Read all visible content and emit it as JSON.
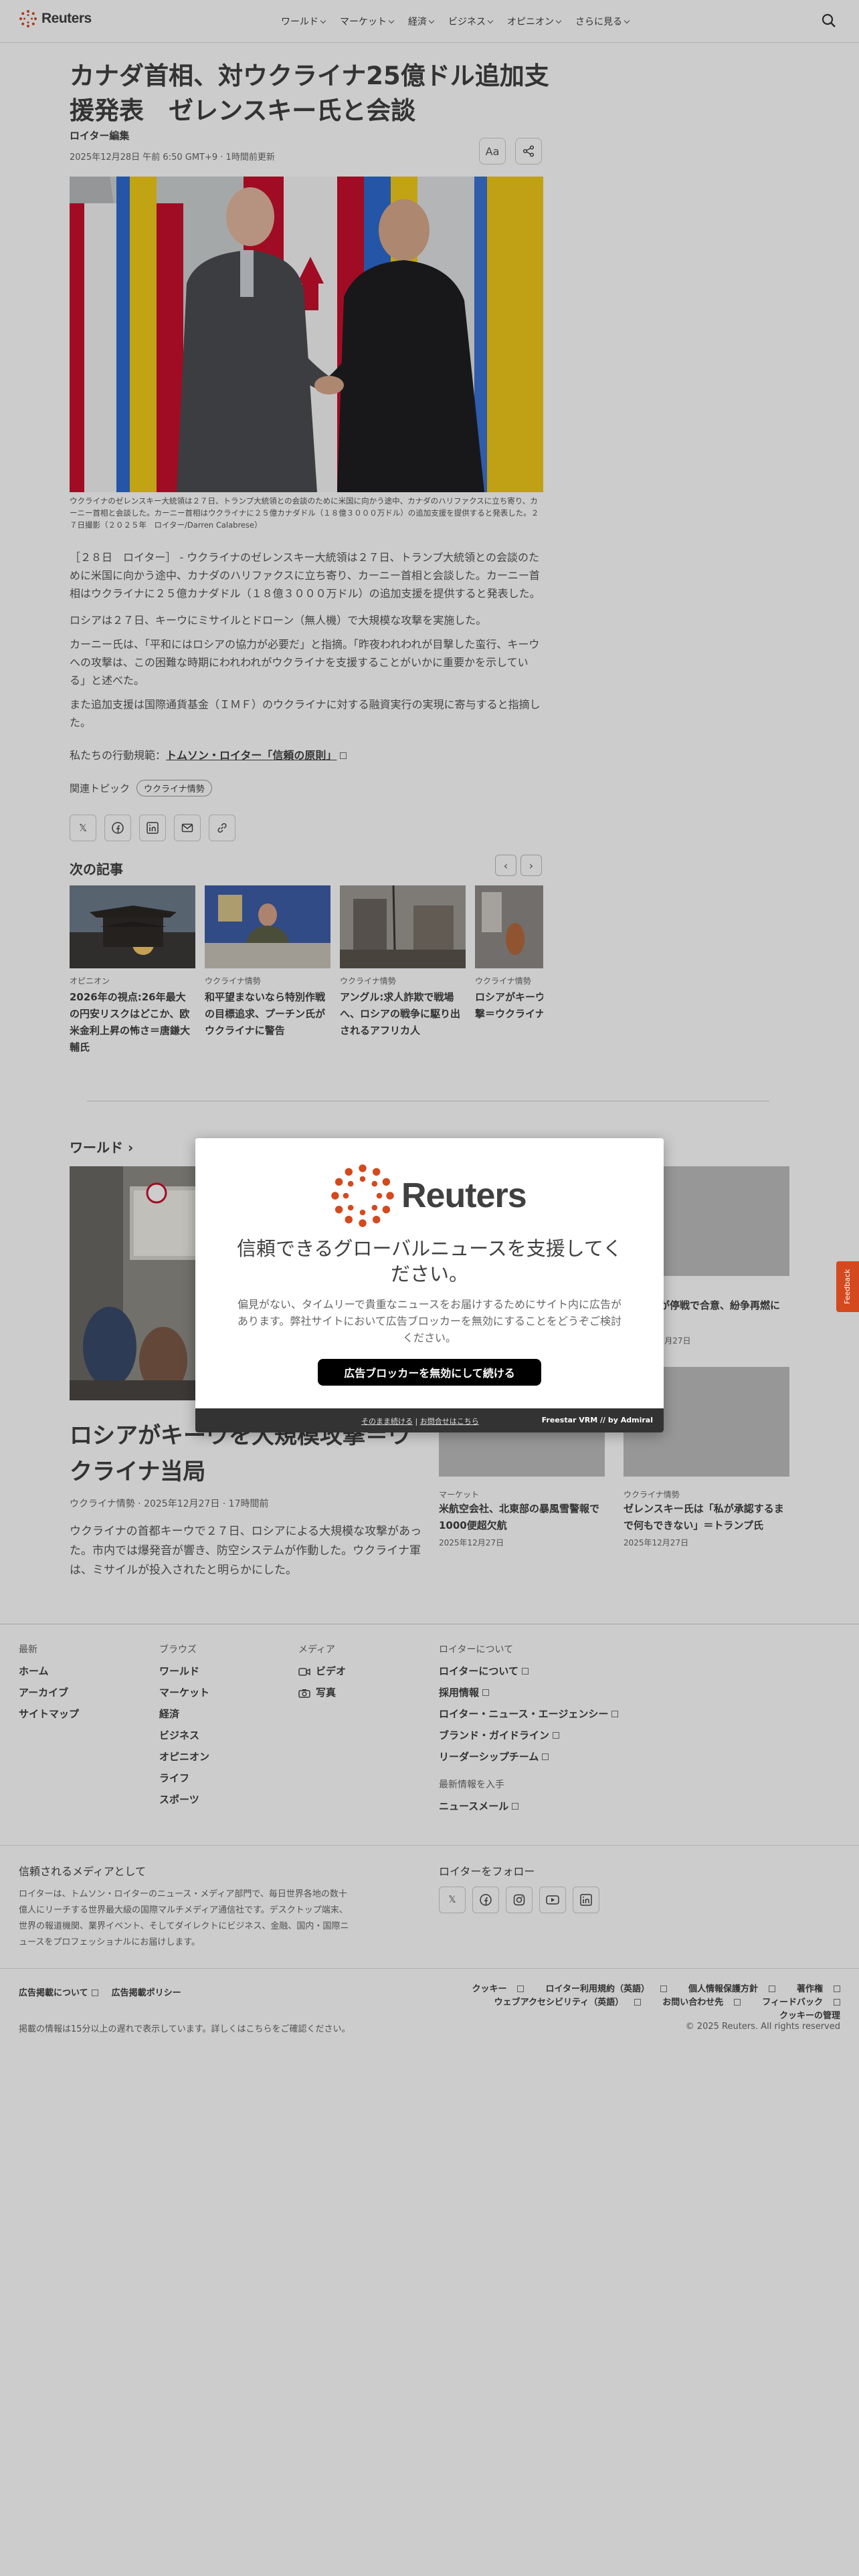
{
  "header": {
    "logo_text": "Reuters",
    "nav": [
      "ワールド",
      "マーケット",
      "経済",
      "ビジネス",
      "オピニオン",
      "さらに見る"
    ]
  },
  "article": {
    "headline": "カナダ首相、対ウクライナ25億ドル追加支援発表　ゼレンスキー氏と会談",
    "byline": "ロイター編集",
    "dateline": "2025年12月28日 午前 6:50 GMT+9 · 1時間前更新",
    "text_size_label": "Aa",
    "caption": "ウクライナのゼレンスキー大統領は２７日、トランプ大統領との会談のために米国に向かう途中、カナダのハリファクスに立ち寄り、カーニー首相と会談した。カーニー首相はウクライナに２５億カナダドル（１８億３０００万ドル）の追加支援を提供すると発表した。２７日撮影（２０２５年　ロイター/Darren Calabrese）",
    "paragraphs": [
      "［２８日　ロイター］ - ウクライナのゼレンスキー大統領は２７日、トランプ大統領との会談のために米国に向かう途中、カナダのハリファクスに立ち寄り、カーニー首相と会談した。カーニー首相はウクライナに２５億カナダドル（１８億３０００万ドル）の追加支援を提供すると発表した。",
      "ロシアは２７日、キーウにミサイルとドローン（無人機）で大規模な攻撃を実施した。",
      "カーニー氏は、「平和にはロシアの協力が必要だ」と指摘。「昨夜われわれが目撃した蛮行、キーウへの攻撃は、この困難な時期にわれわれがウクライナを支援することがいかに重要かを示している」と述べた。",
      "また追加支援は国際通貨基金（ＩＭＦ）のウクライナに対する融資実行の実現に寄与すると指摘した。"
    ],
    "trust_prefix": "私たちの行動規範：",
    "trust_link": "トムソン・ロイター「信頼の原則」",
    "topics_label": "関連トピック",
    "topic_tag": "ウクライナ情勢"
  },
  "next_articles": {
    "title": "次の記事",
    "cards": [
      {
        "category": "オピニオン",
        "title": "2026年の視点:26年最大の円安リスクはどこか、欧米金利上昇の怖さ＝唐鎌大輔氏"
      },
      {
        "category": "ウクライナ情勢",
        "title": "和平望まないなら特別作戦の目標追求、プーチン氏がウクライナに警告"
      },
      {
        "category": "ウクライナ情勢",
        "title": "アングル:求人詐欺で戦場へ、ロシアの戦争に駆り出されるアフリカ人"
      },
      {
        "category": "ウクライナ情勢",
        "title": "ロシアがキーウに大規模攻撃＝ウクライナ"
      }
    ]
  },
  "world": {
    "title": "ワールド",
    "main": {
      "headline": "ロシアがキーウを大規模攻撃＝ウクライナ当局",
      "meta": "ウクライナ情勢 · 2025年12月27日 · 17時間前",
      "summary": "ウクライナの首都キーウで２７日、ロシアによる大規模な攻撃があった。市内では爆発音が響き、防空システムが作動した。ウクライナ軍は、ミサイルが投入されたと明らかにした。"
    },
    "side": [
      {
        "category": "",
        "title": "ンボジアが停戦で合意、紛争再燃に終止符か",
        "date": "12月27日"
      },
      {
        "category": "マーケット",
        "title": "米航空会社、北東部の暴風雪警報で1000便超欠航",
        "date": "2025年12月27日"
      },
      {
        "category": "ウクライナ情勢",
        "title": "ゼレンスキー氏は「私が承認するまで何もできない」＝トランプ氏",
        "date": "2025年12月27日"
      }
    ]
  },
  "modal": {
    "logo_text": "Reuters",
    "title": "信頼できるグローバルニュースを支援してください。",
    "body": "偏見がない、タイムリーで貴重なニュースをお届けするためにサイト内に広告があります。弊社サイトにおいて広告ブロッカーを無効にすることをどうぞご検討ください。",
    "button": "広告ブロッカーを無効にして続ける",
    "continue_link": "そのまま続ける",
    "contact_link": "お問合せはこちら",
    "brand": "Freestar VRM // by Admiral"
  },
  "feedback_label": "Feedback",
  "footer": {
    "col1": {
      "head": "最新",
      "items": [
        "ホーム",
        "アーカイブ",
        "サイトマップ"
      ]
    },
    "col2": {
      "head": "ブラウズ",
      "items": [
        "ワールド",
        "マーケット",
        "経済",
        "ビジネス",
        "オピニオン",
        "ライフ",
        "スポーツ"
      ]
    },
    "col3": {
      "head": "メディア",
      "items": [
        "ビデオ",
        "写真"
      ]
    },
    "col4": {
      "head": "ロイターについて",
      "items": [
        "ロイターについて",
        "採用情報",
        "ロイター・ニュース・エージェンシー",
        "ブランド・ガイドライン",
        "リーダーシップチーム"
      ],
      "head2": "最新情報を入手",
      "items2": [
        "ニュースメール"
      ]
    },
    "trusted_head": "信頼されるメディアとして",
    "trusted_text": "ロイターは、トムソン・ロイターのニュース・メディア部門で、毎日世界各地の数十億人にリーチする世界最大級の国際マルチメディア通信社です。デスクトップ端末、世界の報道機関、業界イベント、そしてダイレクトにビジネス、金融、国内・国際ニュースをプロフェッショナルにお届けします。",
    "follow_head": "ロイターをフォロー",
    "ad_links": [
      "広告掲載について",
      "広告掲載ポリシー"
    ],
    "legal": [
      "クッキー",
      "ロイター利用規約（英語）",
      "個人情報保護方針",
      "著作権",
      "ウェブアクセシビリティ（英語）",
      "お問い合わせ先",
      "フィードバック",
      "クッキーの管理"
    ],
    "note": "掲載の情報は15分以上の遅れで表示しています。詳しくはこちらをご確認ください。",
    "copyright": "© 2025 Reuters. All rights reserved"
  }
}
